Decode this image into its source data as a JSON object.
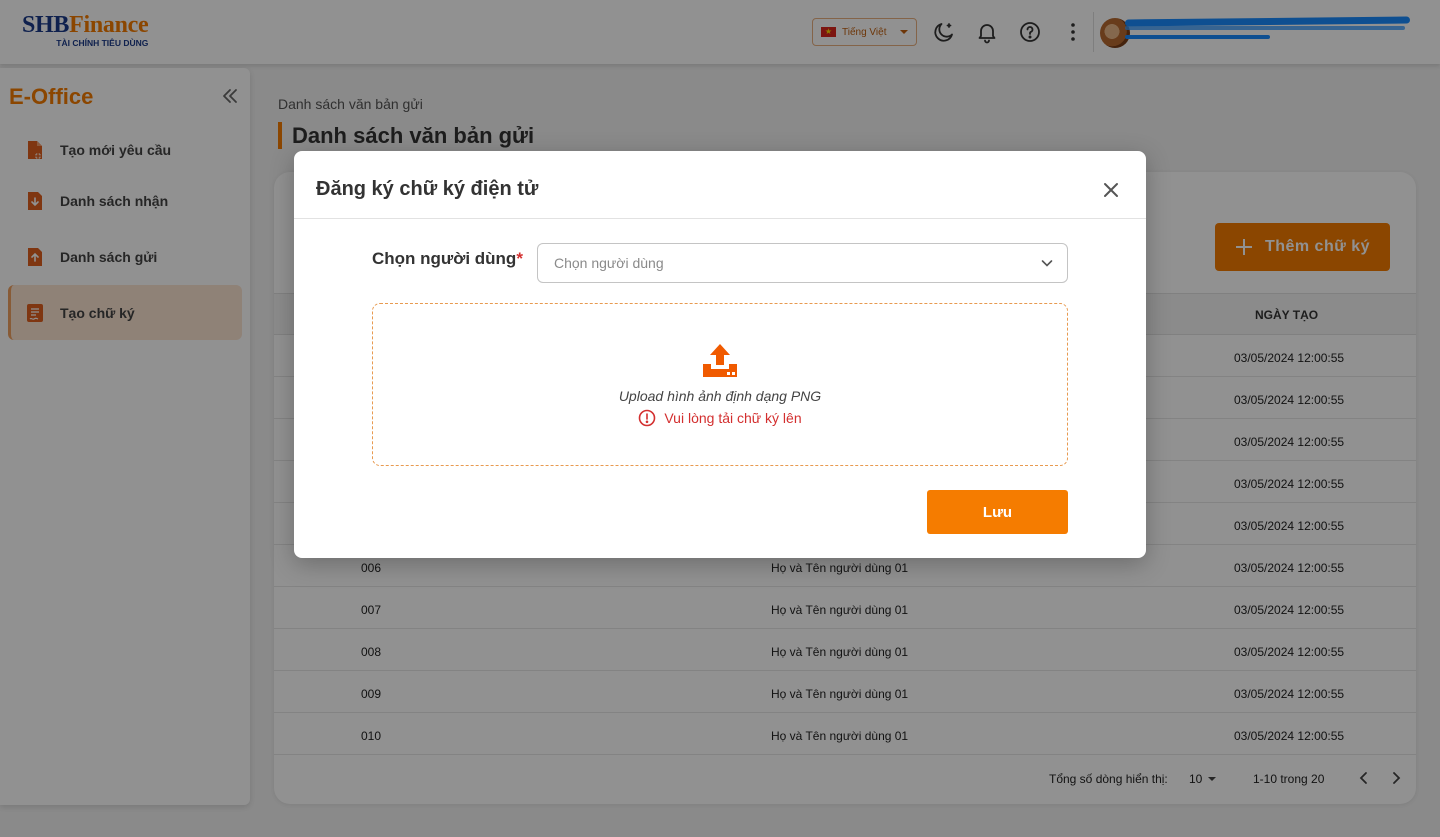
{
  "header": {
    "logo_main_a": "SHB",
    "logo_main_b": "Finance",
    "logo_sub": "TÀI CHÍNH TIÊU DÙNG",
    "language": "Tiếng Việt",
    "icons": [
      "moon-icon",
      "bell-icon",
      "help-icon",
      "more-vertical-icon"
    ]
  },
  "sidebar": {
    "title": "E-Office",
    "items": [
      {
        "label": "Tạo mới yêu cầu",
        "icon": "file-plus-icon"
      },
      {
        "label": "Danh sách nhận",
        "icon": "file-download-icon"
      },
      {
        "label": "Danh sách gửi",
        "icon": "file-upload-icon"
      },
      {
        "label": "Tạo chữ ký",
        "icon": "signature-doc-icon",
        "active": true
      }
    ]
  },
  "main": {
    "breadcrumb": "Danh sách văn bản gửi",
    "title": "Danh sách văn bản gửi",
    "add_button": "Thêm chữ ký",
    "column_date": "NGÀY TẠO",
    "rows": [
      {
        "id": "",
        "name": "",
        "date": "03/05/2024 12:00:55"
      },
      {
        "id": "",
        "name": "",
        "date": "03/05/2024 12:00:55"
      },
      {
        "id": "",
        "name": "",
        "date": "03/05/2024 12:00:55"
      },
      {
        "id": "",
        "name": "",
        "date": "03/05/2024 12:00:55"
      },
      {
        "id": "",
        "name": "",
        "date": "03/05/2024 12:00:55"
      },
      {
        "id": "006",
        "name": "Họ và Tên người dùng 01",
        "date": "03/05/2024 12:00:55"
      },
      {
        "id": "007",
        "name": "Họ và Tên người dùng 01",
        "date": "03/05/2024 12:00:55"
      },
      {
        "id": "008",
        "name": "Họ và Tên người dùng 01",
        "date": "03/05/2024 12:00:55"
      },
      {
        "id": "009",
        "name": "Họ và Tên người dùng 01",
        "date": "03/05/2024 12:00:55"
      },
      {
        "id": "010",
        "name": "Họ và Tên người dùng 01",
        "date": "03/05/2024 12:00:55"
      }
    ],
    "pagination": {
      "rows_label": "Tổng số dòng hiển thị:",
      "page_size": "10",
      "range": "1-10 trong 20"
    }
  },
  "modal": {
    "title": "Đăng ký chữ ký điện tử",
    "user_label": "Chọn người dùng",
    "required_mark": "*",
    "user_placeholder": "Chọn người dùng",
    "upload_text": "Upload hình ảnh định dạng PNG",
    "upload_error": "Vui lòng tải chữ ký lên",
    "save_label": "Lưu"
  },
  "colors": {
    "accent": "#f57c00",
    "brand_blue": "#1b3a8a",
    "error": "#d32f2f"
  }
}
